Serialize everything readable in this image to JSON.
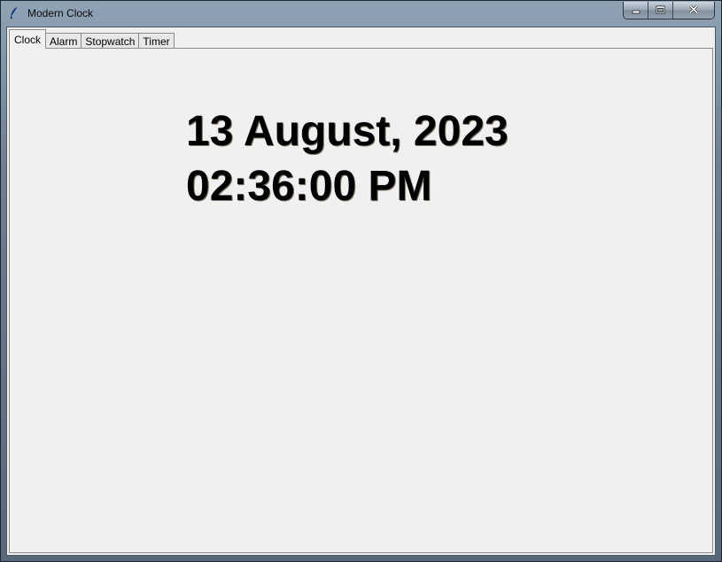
{
  "window": {
    "title": "Modern Clock",
    "controls": {
      "minimize_icon": "minimize-icon",
      "maximize_icon": "maximize-icon",
      "close_icon": "close-icon"
    }
  },
  "tabs": [
    {
      "label": "Clock",
      "active": true
    },
    {
      "label": "Alarm",
      "active": false
    },
    {
      "label": "Stopwatch",
      "active": false
    },
    {
      "label": "Timer",
      "active": false
    }
  ],
  "clock": {
    "date": "13 August, 2023",
    "time": "02:36:00 PM"
  },
  "colors": {
    "panel_bg": "#f0f0f0",
    "text": "#000000"
  }
}
